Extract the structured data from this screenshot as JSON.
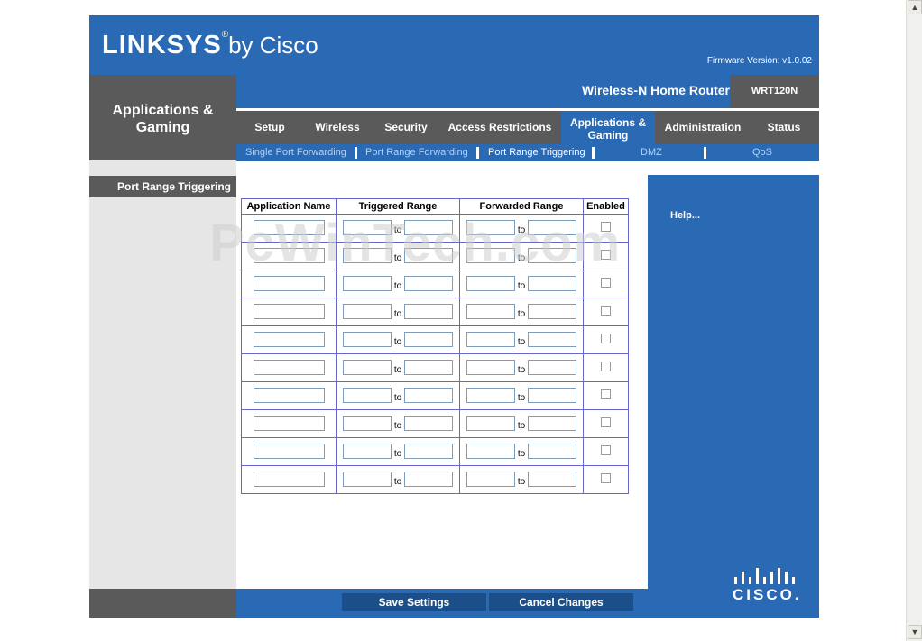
{
  "header": {
    "brand_main": "LINKSYS",
    "brand_reg": "®",
    "brand_by": "by Cisco",
    "firmware": "Firmware Version: v1.0.02"
  },
  "section": {
    "title": "Applications & Gaming"
  },
  "product": {
    "name": "Wireless-N Home Router",
    "model": "WRT120N"
  },
  "tabs": [
    {
      "label": "Setup"
    },
    {
      "label": "Wireless"
    },
    {
      "label": "Security"
    },
    {
      "label": "Access Restrictions"
    },
    {
      "label_line1": "Applications &",
      "label_line2": "Gaming",
      "active": true
    },
    {
      "label": "Administration"
    },
    {
      "label": "Status"
    }
  ],
  "subtabs": [
    {
      "label": "Single Port Forwarding"
    },
    {
      "label": "Port Range Forwarding"
    },
    {
      "label": "Port Range Triggering",
      "active": true
    },
    {
      "label": "DMZ"
    },
    {
      "label": "QoS"
    }
  ],
  "left": {
    "subsection": "Port Range Triggering"
  },
  "table": {
    "headers": [
      "Application Name",
      "Triggered Range",
      "Forwarded Range",
      "Enabled"
    ],
    "to_label": "to",
    "rows": 10
  },
  "help": {
    "link": "Help..."
  },
  "logo": {
    "text": "CISCO."
  },
  "footer": {
    "save": "Save Settings",
    "cancel": "Cancel Changes"
  },
  "watermark": "PcWinTech.com",
  "colors": {
    "blue": "#2a69b4",
    "dark_grey": "#5a5a5a",
    "light_grey": "#e6e6e6",
    "subtab_text": "#b4d2f5"
  }
}
